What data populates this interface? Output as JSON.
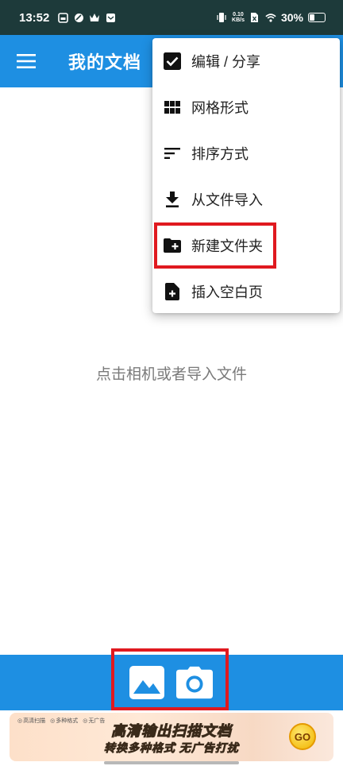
{
  "status_bar": {
    "time": "13:52",
    "net_speed_value": "0.10",
    "net_speed_unit": "KB/s",
    "battery_percent": "30%",
    "icons": [
      "notification-icon",
      "app-icon",
      "crown-icon",
      "message-icon",
      "vibrate-icon",
      "sim-x-icon",
      "wifi-icon",
      "battery-icon"
    ]
  },
  "app_bar": {
    "title": "我的文档",
    "menu_icon": "hamburger-menu-icon",
    "background": "#1e8fe2"
  },
  "dropdown_menu": {
    "items": [
      {
        "label": "编辑 / 分享",
        "icon": "checkbox-checked-icon"
      },
      {
        "label": "网格形式",
        "icon": "grid-view-icon"
      },
      {
        "label": "排序方式",
        "icon": "sort-icon"
      },
      {
        "label": "从文件导入",
        "icon": "download-icon"
      },
      {
        "label": "新建文件夹",
        "icon": "new-folder-icon",
        "highlighted": true
      },
      {
        "label": "插入空白页",
        "icon": "add-page-icon"
      }
    ]
  },
  "main": {
    "empty_hint": "点击相机或者导入文件"
  },
  "bottom_bar": {
    "buttons": [
      {
        "name": "gallery-button",
        "icon": "image-icon"
      },
      {
        "name": "camera-button",
        "icon": "camera-icon"
      }
    ],
    "highlight_color": "#e0191f"
  },
  "ad_banner": {
    "tags": [
      "高清扫描",
      "多种格式",
      "无广告"
    ],
    "title": "高清输出扫描文档",
    "subtitle": "转换多种格式 无广告打扰",
    "go_label": "GO"
  }
}
